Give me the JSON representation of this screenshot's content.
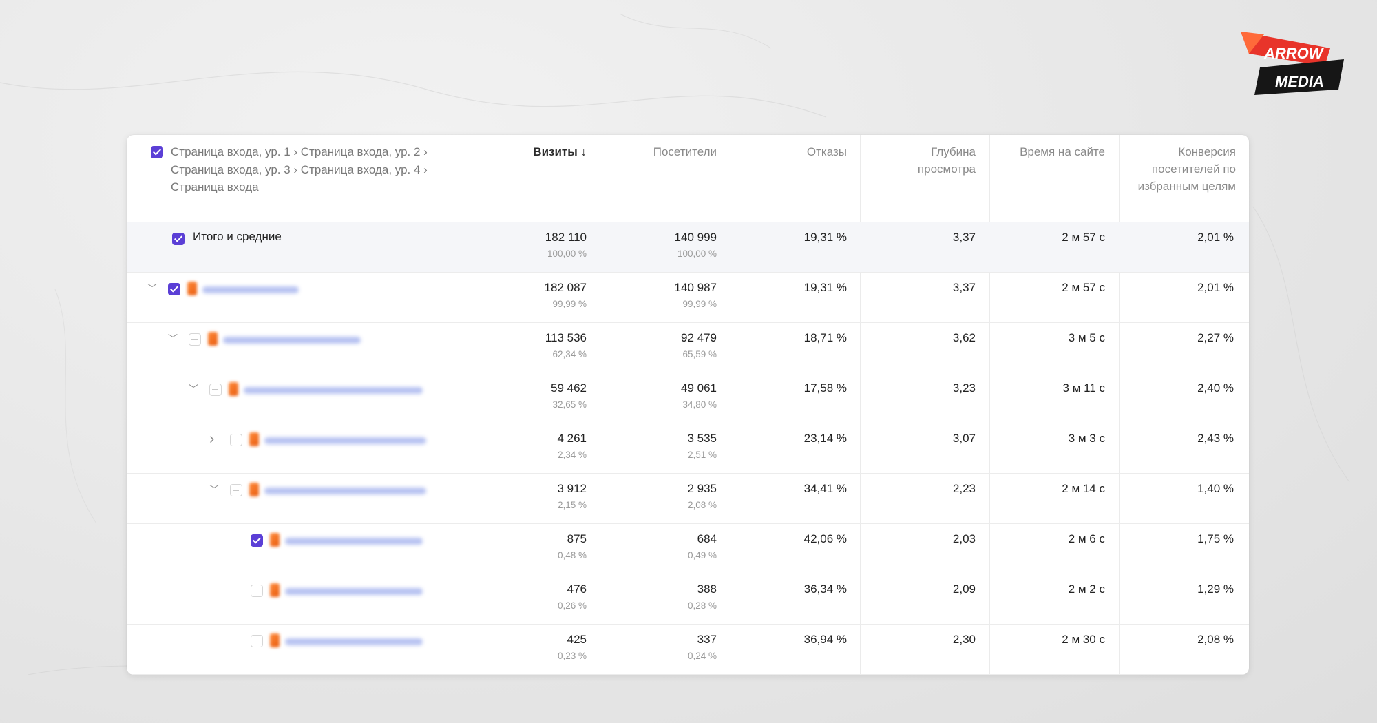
{
  "logo": {
    "line1": "ARROW",
    "line2": "MEDIA"
  },
  "header": {
    "dimension_label": "Страница входа, ур. 1 › Страница входа, ур. 2 › Страница входа, ур. 3 › Страница входа, ур. 4 › Страница входа",
    "columns": {
      "visits": "Визиты ↓",
      "visitors": "Посетители",
      "bounces": "Отказы",
      "depth": "Глубина просмотра",
      "time": "Время на сайте",
      "conversion": "Конверсия посетителей по избранным целям"
    }
  },
  "total": {
    "label": "Итого и средние",
    "visits": "182 110",
    "visits_pct": "100,00 %",
    "visitors": "140 999",
    "visitors_pct": "100,00 %",
    "bounces": "19,31 %",
    "depth": "3,37",
    "time": "2 м 57 с",
    "conversion": "2,01 %"
  },
  "rows": [
    {
      "visits": "182 087",
      "visits_pct": "99,99 %",
      "visitors": "140 987",
      "visitors_pct": "99,99 %",
      "bounces": "19,31 %",
      "depth": "3,37",
      "time": "2 м 57 с",
      "conversion": "2,01 %"
    },
    {
      "visits": "113 536",
      "visits_pct": "62,34 %",
      "visitors": "92 479",
      "visitors_pct": "65,59 %",
      "bounces": "18,71 %",
      "depth": "3,62",
      "time": "3 м 5 с",
      "conversion": "2,27 %"
    },
    {
      "visits": "59 462",
      "visits_pct": "32,65 %",
      "visitors": "49 061",
      "visitors_pct": "34,80 %",
      "bounces": "17,58 %",
      "depth": "3,23",
      "time": "3 м 11 с",
      "conversion": "2,40 %"
    },
    {
      "visits": "4 261",
      "visits_pct": "2,34 %",
      "visitors": "3 535",
      "visitors_pct": "2,51 %",
      "bounces": "23,14 %",
      "depth": "3,07",
      "time": "3 м 3 с",
      "conversion": "2,43 %"
    },
    {
      "visits": "3 912",
      "visits_pct": "2,15 %",
      "visitors": "2 935",
      "visitors_pct": "2,08 %",
      "bounces": "34,41 %",
      "depth": "2,23",
      "time": "2 м 14 с",
      "conversion": "1,40 %"
    },
    {
      "visits": "875",
      "visits_pct": "0,48 %",
      "visitors": "684",
      "visitors_pct": "0,49 %",
      "bounces": "42,06 %",
      "depth": "2,03",
      "time": "2 м 6 с",
      "conversion": "1,75 %"
    },
    {
      "visits": "476",
      "visits_pct": "0,26 %",
      "visitors": "388",
      "visitors_pct": "0,28 %",
      "bounces": "36,34 %",
      "depth": "2,09",
      "time": "2 м 2 с",
      "conversion": "1,29 %"
    },
    {
      "visits": "425",
      "visits_pct": "0,23 %",
      "visitors": "337",
      "visitors_pct": "0,24 %",
      "bounces": "36,94 %",
      "depth": "2,30",
      "time": "2 м 30 с",
      "conversion": "2,08 %"
    }
  ],
  "colors": {
    "accent": "#5b3fd6",
    "favicon": "#f07020",
    "url_blur": "#7a8fe6"
  }
}
